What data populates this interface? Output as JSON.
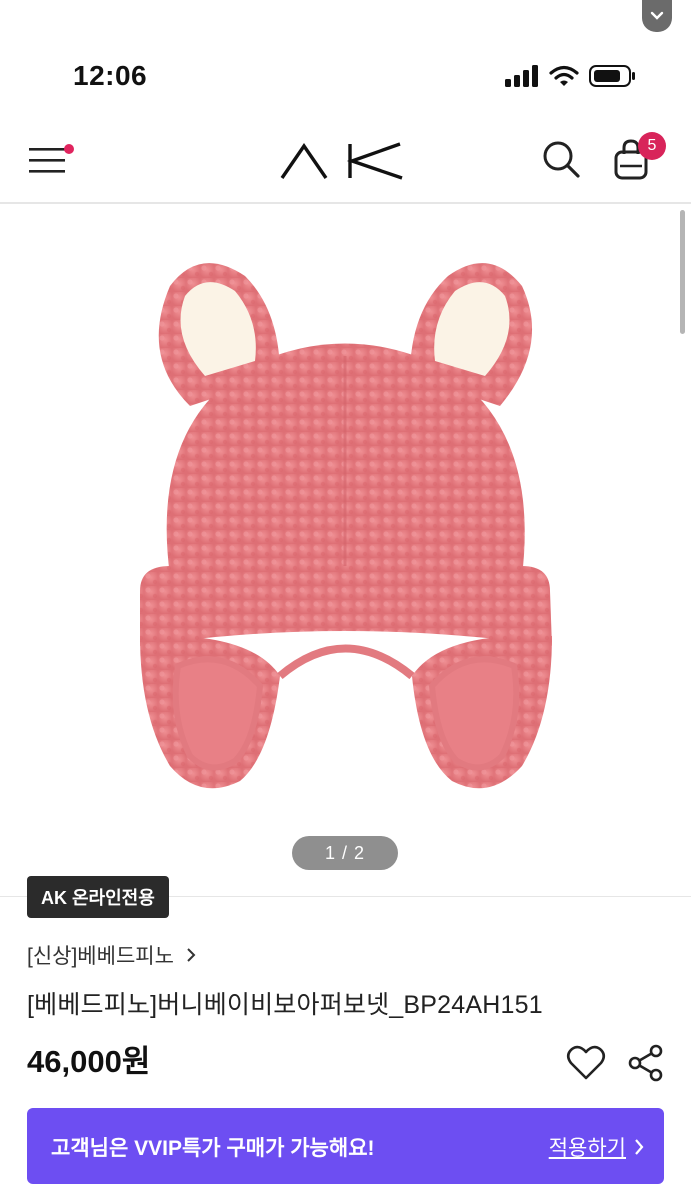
{
  "status_bar": {
    "time": "12:06"
  },
  "header": {
    "logo_text": "AK",
    "cart_count": "5"
  },
  "gallery": {
    "pager": "1 / 2"
  },
  "product": {
    "badge": "AK 온라인전용",
    "brand": "[신상]베베드피노",
    "title": "[베베드피노]버니베이비보아퍼보넷_BP24AH151",
    "price": "46,000원"
  },
  "vvip_banner": {
    "message": "고객님은 VVIP특가 구매가 가능해요!",
    "action": "적용하기"
  },
  "colors": {
    "accent": "#6d4ef2",
    "badge": "#d8245a",
    "hat_pink": "#e87a7f"
  }
}
